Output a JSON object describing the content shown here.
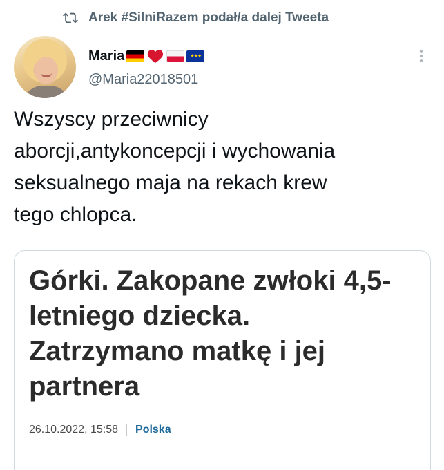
{
  "retweet": {
    "text": "Arek #SilniRazem podał/a dalej Tweeta"
  },
  "author": {
    "name": "Maria",
    "handle": "@Maria22018501"
  },
  "tweet": {
    "lines": [
      "Wszyscy przeciwnicy",
      "aborcji,antykoncepcji i wychowania",
      "seksualnego maja na rekach krew",
      "tego chlopca."
    ]
  },
  "card": {
    "headline_lines": [
      "Górki. Zakopane zwłoki 4,5-",
      "letniego dziecka.",
      "Zatrzymano matkę i jej",
      "partnera"
    ],
    "date": "26.10.2022, 15:58",
    "category": "Polska"
  },
  "colors": {
    "secondary_text": "#536471",
    "border": "#cfd9de",
    "category": "#1e6a9a"
  },
  "icons": [
    "retweet-icon",
    "flag-germany-icon",
    "red-heart-icon",
    "flag-poland-icon",
    "flag-eu-icon",
    "more-options-icon"
  ]
}
